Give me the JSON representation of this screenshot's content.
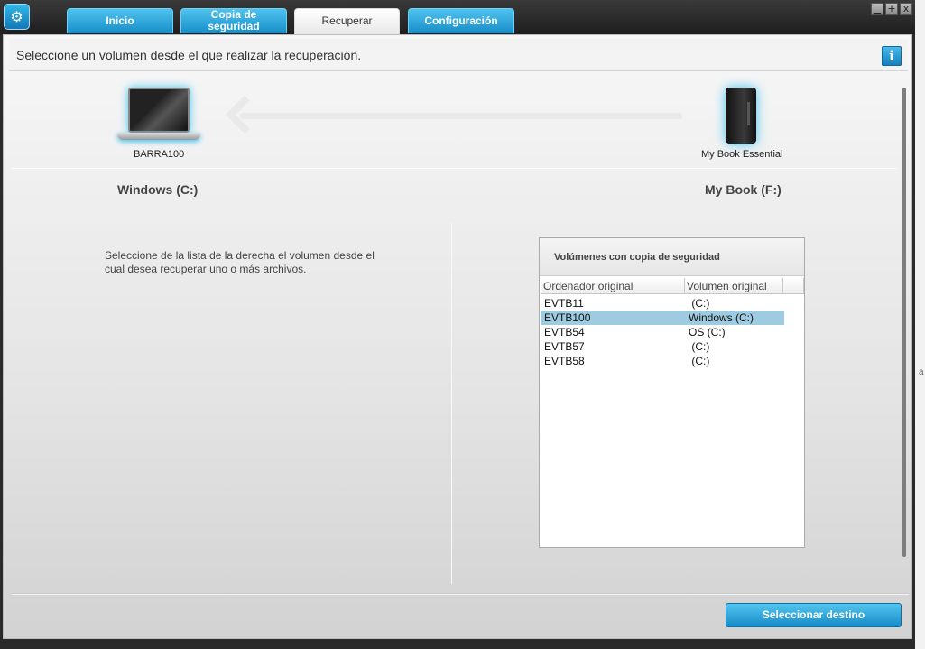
{
  "tabs": [
    {
      "label": "Inicio"
    },
    {
      "label": "Copia de seguridad"
    },
    {
      "label": "Recuperar"
    },
    {
      "label": "Configuración"
    }
  ],
  "window_controls": {
    "minimize": "▁",
    "maximize": "+",
    "close": "x"
  },
  "instruction": "Seleccione un volumen desde el que realizar la recuperación.",
  "info_icon": "i",
  "source": {
    "device": "BARRA100",
    "volume": "Windows (C:)"
  },
  "destination": {
    "device": "My Book Essential",
    "volume": "My Book (F:)"
  },
  "left_help": "Seleccione de la lista de la derecha el volumen desde el cual desea recuperar uno o más archivos.",
  "panel": {
    "title": "Volúmenes con copia de seguridad",
    "columns": [
      "Ordenador original",
      "Volumen original"
    ],
    "rows": [
      {
        "computer": "EVTB11",
        "volume": " (C:)"
      },
      {
        "computer": "EVTB100",
        "volume": "Windows (C:)",
        "selected": true
      },
      {
        "computer": "EVTB54",
        "volume": "OS (C:)"
      },
      {
        "computer": "EVTB57",
        "volume": " (C:)"
      },
      {
        "computer": "EVTB58",
        "volume": " (C:)"
      }
    ]
  },
  "select_destination_button": "Seleccionar destino",
  "edge_glyph": "a",
  "colors": {
    "accent": "#1b93cf",
    "selected_row": "#9fcbe0"
  }
}
